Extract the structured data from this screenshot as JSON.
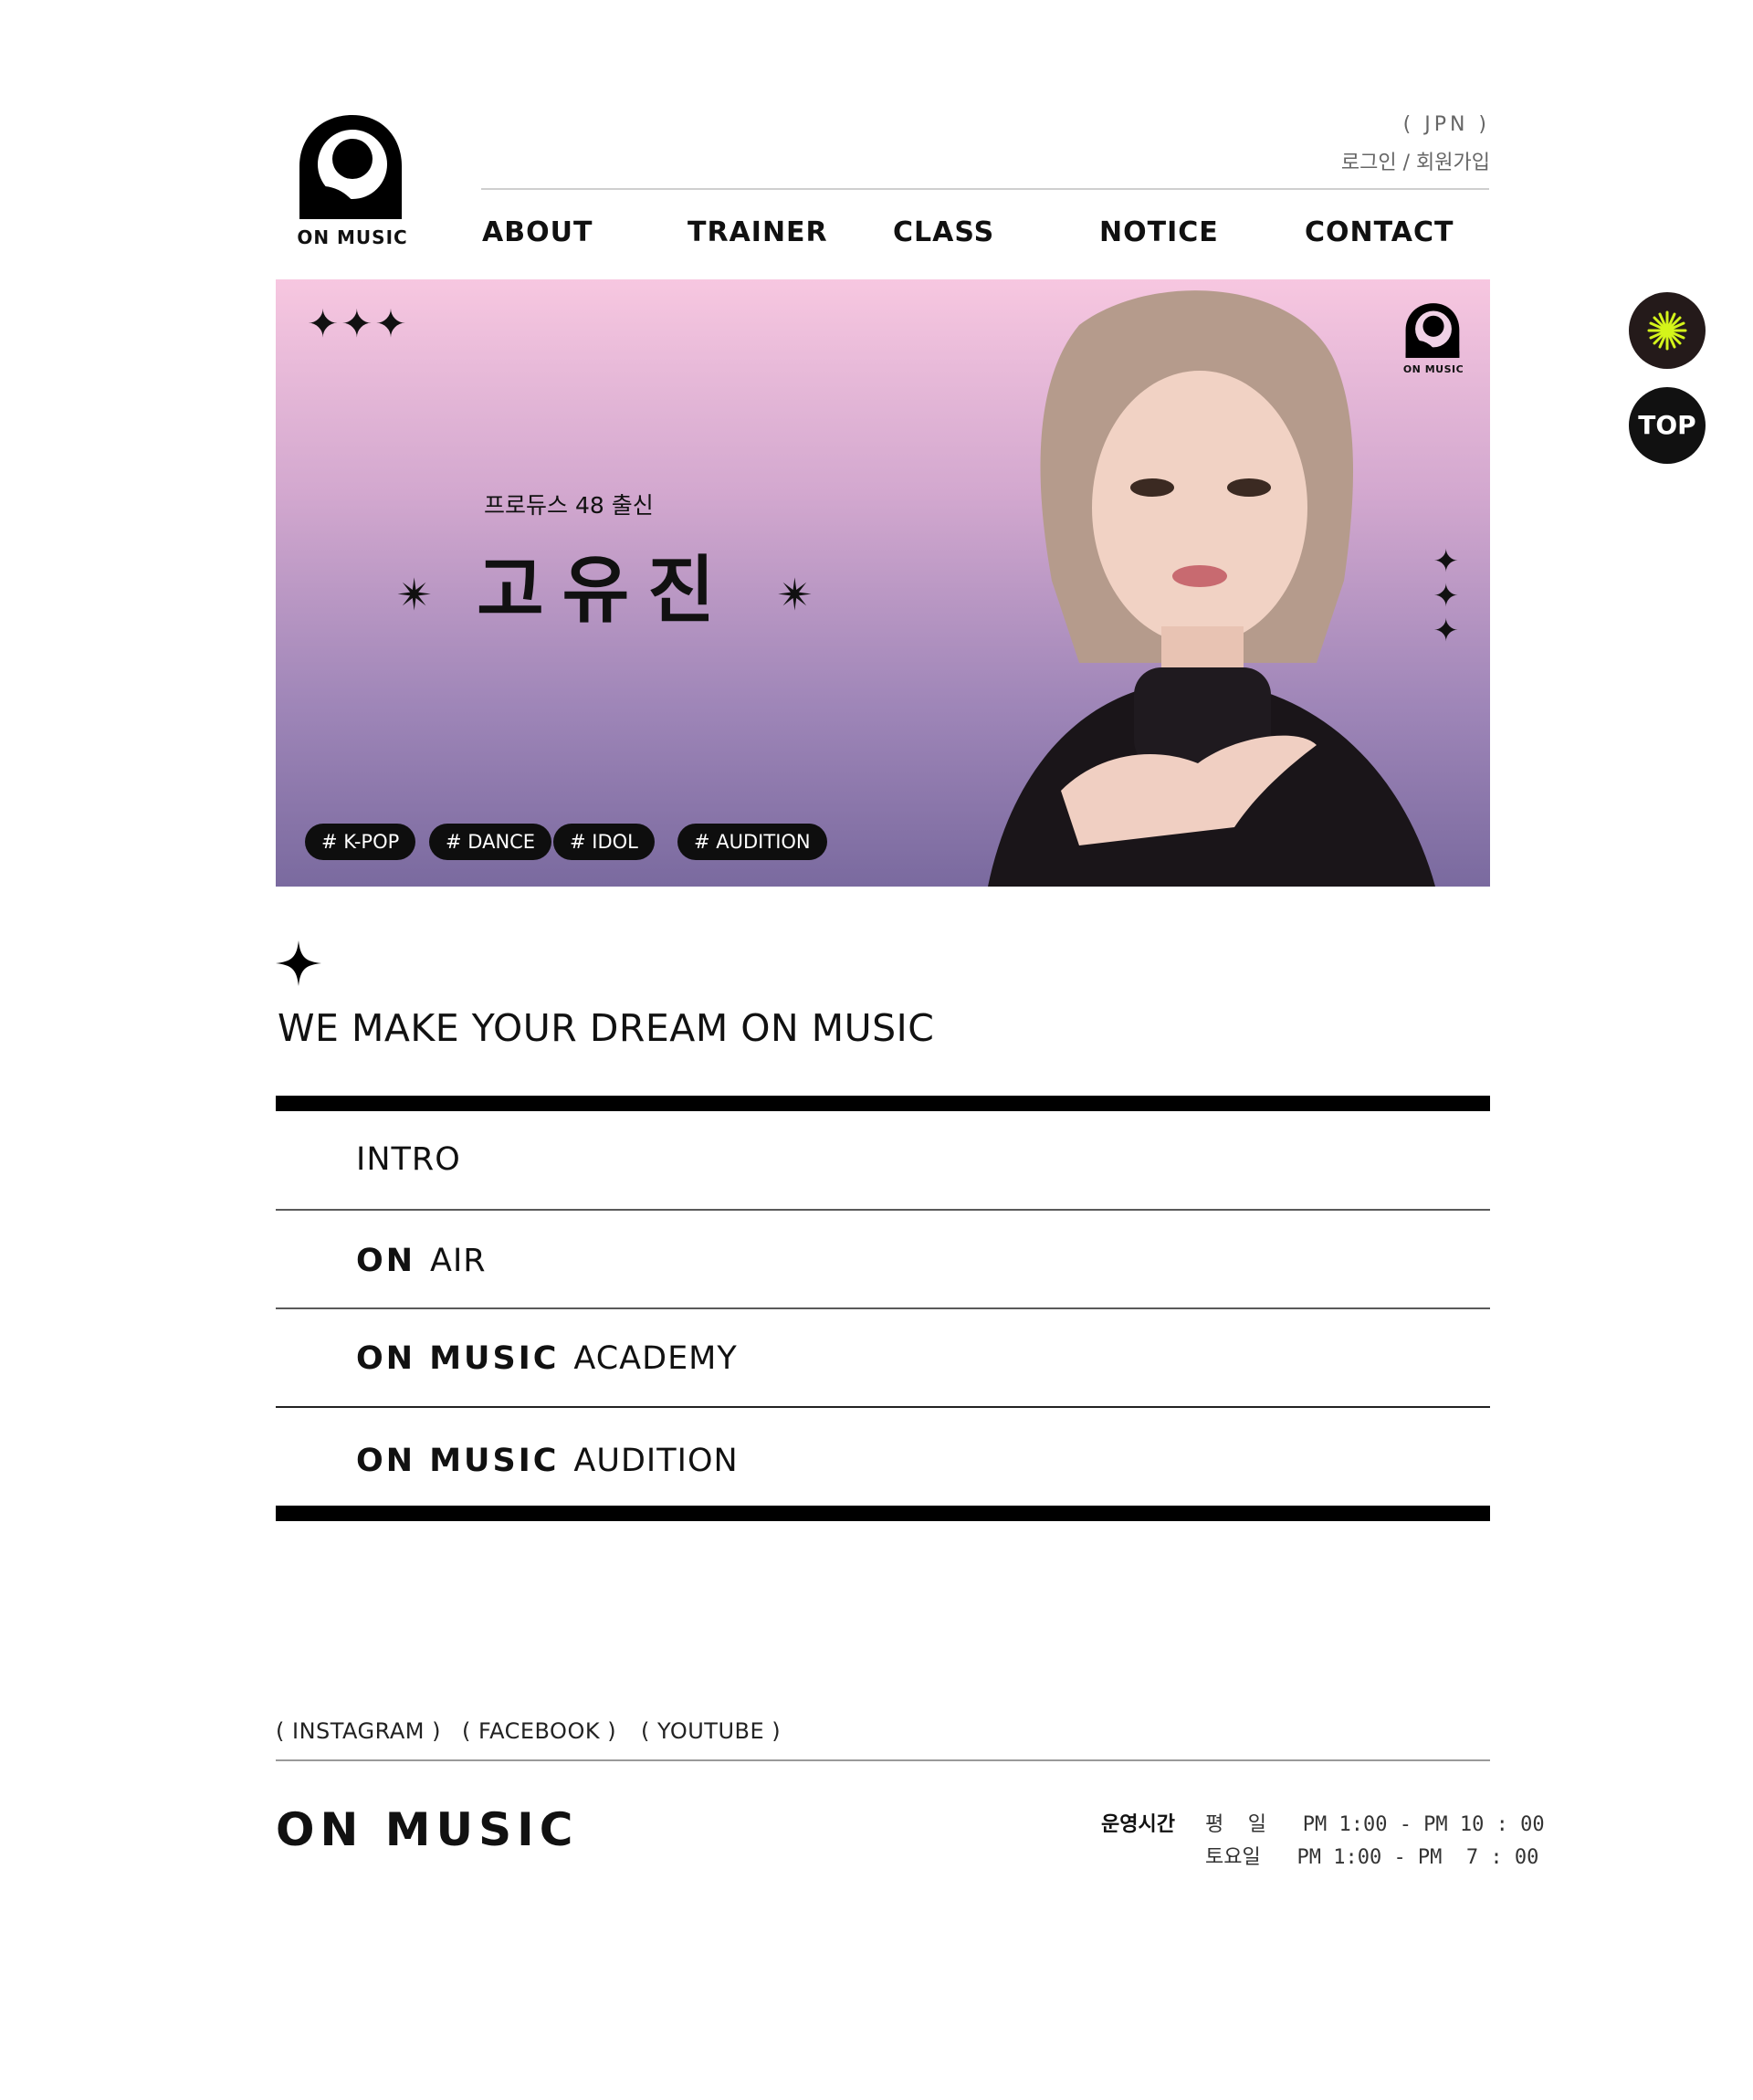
{
  "header": {
    "logo_text": "ON MUSIC",
    "lang": "( JPN )",
    "auth": "로그인 / 회원가입",
    "nav": [
      "ABOUT",
      "TRAINER",
      "CLASS",
      "NOTICE",
      "CONTACT"
    ]
  },
  "banner": {
    "subtitle": "프로듀스 48 출신",
    "name": "고유진",
    "tags": [
      "# K-POP",
      "# DANCE",
      "# IDOL",
      "# AUDITION"
    ],
    "mini_logo_text": "ON MUSIC"
  },
  "intro": {
    "headline": "WE MAKE YOUR DREAM ON MUSIC",
    "items": [
      {
        "brand": "",
        "label": "INTRO"
      },
      {
        "brand": "ON",
        "label": "AIR"
      },
      {
        "brand": "ON MUSIC",
        "label": "ACADEMY"
      },
      {
        "brand": "ON MUSIC",
        "label": "AUDITION"
      }
    ]
  },
  "footer": {
    "social": [
      "( INSTAGRAM )",
      "( FACEBOOK )",
      "( YOUTUBE )"
    ],
    "logo": "ON MUSIC",
    "hours_label": "운영시간",
    "hours": [
      {
        "day": "평  일",
        "time": "PM 1:00 - PM 10 : 00"
      },
      {
        "day": "토요일",
        "time": "PM 1:00 - PM  7 : 00"
      }
    ]
  },
  "floating": {
    "top_label": "TOP",
    "accent": "#d4f51a"
  }
}
